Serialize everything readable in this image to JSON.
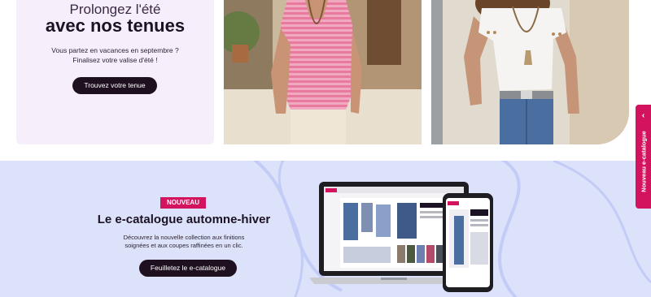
{
  "promo": {
    "kicker": "Prolongez l'été",
    "title": "avec nos tenues",
    "text_line1": "Vous partez en vacances en septembre ?",
    "text_line2": "Finalisez votre valise d'été !",
    "button": "Trouvez votre tenue"
  },
  "catalogue": {
    "badge": "NOUVEAU",
    "title": "Le e-catalogue automne-hiver",
    "desc_line1": "Découvrez la nouvelle collection aux finitions",
    "desc_line2": "soignées et aux coupes raffinées en un clic.",
    "button": "Feuilletez le e-catalogue"
  },
  "side_tab": {
    "label": "Nouveau e-catalogue",
    "icon": "chevron-left-icon"
  },
  "colors": {
    "accent": "#d4135f",
    "dark": "#1f1020",
    "promo_bg": "#f6eefb",
    "catalogue_bg": "#dde2fb"
  }
}
